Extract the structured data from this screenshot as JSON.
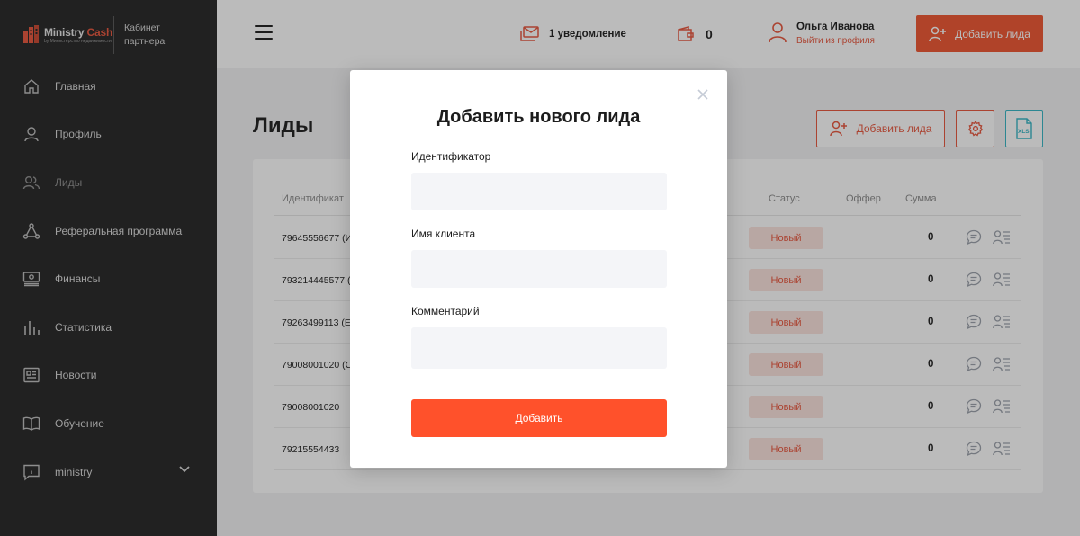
{
  "brand": {
    "name_part1": "Ministry ",
    "name_part2": "Cash",
    "subtitle": "by Министерство недвижимости",
    "cabinet": "Кабинет партнера"
  },
  "sidebar": {
    "items": [
      {
        "label": "Главная",
        "icon": "home-icon"
      },
      {
        "label": "Профиль",
        "icon": "user-icon"
      },
      {
        "label": "Лиды",
        "icon": "users-icon"
      },
      {
        "label": "Реферальная программа",
        "icon": "network-icon"
      },
      {
        "label": "Финансы",
        "icon": "money-icon"
      },
      {
        "label": "Статистика",
        "icon": "bar-chart-icon"
      },
      {
        "label": "Новости",
        "icon": "newspaper-icon"
      },
      {
        "label": "Обучение",
        "icon": "book-icon"
      },
      {
        "label": "ministry",
        "icon": "info-icon"
      }
    ]
  },
  "header": {
    "notifications": "1 уведомление",
    "wallet_count": "0",
    "user_name": "Ольга Иванова",
    "logout": "Выйти из профиля",
    "add_lead": "Добавить лида"
  },
  "page": {
    "title": "Лиды",
    "add_lead": "Добавить лида"
  },
  "table": {
    "columns": {
      "ident": "Идентификат",
      "status": "Статус",
      "offer": "Оффер",
      "sum": "Сумма"
    },
    "rows": [
      {
        "ident": "79645556677 (И",
        "status": "Новый",
        "sum": "0"
      },
      {
        "ident": "793214445577 (А",
        "status": "Новый",
        "sum": "0"
      },
      {
        "ident": "79263499113 (ЕЛ",
        "status": "Новый",
        "sum": "0"
      },
      {
        "ident": "79008001020 (С",
        "status": "Новый",
        "sum": "0"
      },
      {
        "ident": "79008001020",
        "status": "Новый",
        "sum": "0"
      },
      {
        "ident": "79215554433",
        "status": "Новый",
        "sum": "0"
      }
    ]
  },
  "modal": {
    "title": "Добавить нового лида",
    "fields": {
      "identifier_label": "Идентификатор",
      "identifier_value": "",
      "client_label": "Имя клиента",
      "client_value": "",
      "comment_label": "Комментарий",
      "comment_value": ""
    },
    "submit": "Добавить"
  },
  "colors": {
    "accent": "#f0542f",
    "sidebar_bg": "#232323",
    "status_bg": "#fbe2dd",
    "xls": "#33b5c4"
  }
}
